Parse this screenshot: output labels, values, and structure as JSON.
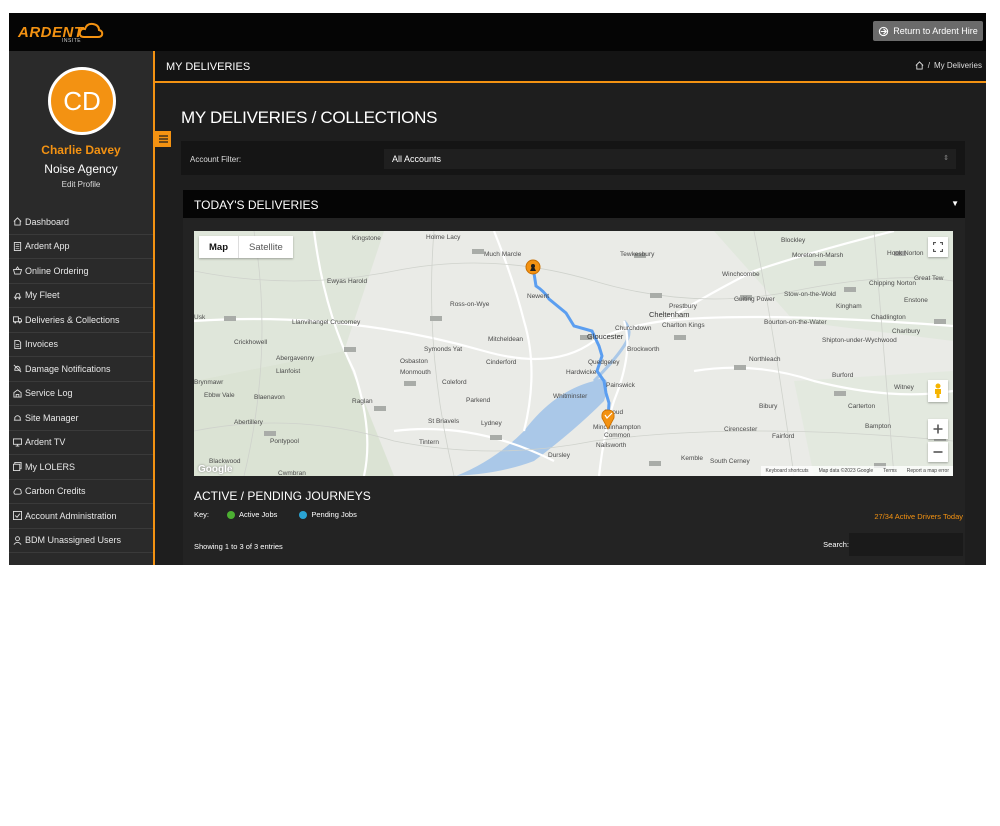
{
  "brand": {
    "name": "ARDENT",
    "sub": "INSITE",
    "accent": "#f39212"
  },
  "topbar": {
    "return_label": "Return to Ardent Hire"
  },
  "user": {
    "initials": "CD",
    "name": "Charlie Davey",
    "company": "Noise Agency",
    "edit_profile": "Edit Profile"
  },
  "nav": {
    "items": [
      {
        "label": "Dashboard",
        "icon": "home-icon"
      },
      {
        "label": "Ardent App",
        "icon": "document-icon"
      },
      {
        "label": "Online Ordering",
        "icon": "basket-icon"
      },
      {
        "label": "My Fleet",
        "icon": "fleet-icon"
      },
      {
        "label": "Deliveries & Collections",
        "icon": "truck-icon"
      },
      {
        "label": "Invoices",
        "icon": "invoice-icon"
      },
      {
        "label": "Damage Notifications",
        "icon": "alert-slash-icon"
      },
      {
        "label": "Service Log",
        "icon": "service-icon"
      },
      {
        "label": "Site Manager",
        "icon": "site-icon"
      },
      {
        "label": "Ardent TV",
        "icon": "monitor-icon"
      },
      {
        "label": "My LOLERS",
        "icon": "lolers-icon"
      },
      {
        "label": "Carbon Credits",
        "icon": "carbon-icon"
      },
      {
        "label": "Account Administration",
        "icon": "check-square-icon"
      },
      {
        "label": "BDM Unassigned Users",
        "icon": "user-icon"
      }
    ]
  },
  "header": {
    "section_title": "MY DELIVERIES",
    "breadcrumb_current": "My Deliveries",
    "breadcrumb_sep": "/"
  },
  "main": {
    "title": "MY DELIVERIES / COLLECTIONS",
    "filter": {
      "label": "Account Filter:",
      "value": "All Accounts"
    }
  },
  "deliveries": {
    "title": "TODAY'S DELIVERIES",
    "map": {
      "tabs": [
        "Map",
        "Satellite"
      ],
      "places": [
        "Kingstone",
        "Holme Lacy",
        "Much Marcle",
        "Tewkesbury",
        "Blockley",
        "Moreton-in-Marsh",
        "Hook Norton",
        "Ewyas Harold",
        "Winchcombe",
        "Great Tew",
        "Newent",
        "Stow-on-the-Wold",
        "Chipping Norton",
        "Ross-on-Wye",
        "Guiting Power",
        "Prestbury",
        "Kingham",
        "Enstone",
        "Usk",
        "Llanvihangel Crucorney",
        "Cheltenham",
        "Charlton Kings",
        "Bourton-on-the-Water",
        "Chadlington",
        "Churchdown",
        "Charlbury",
        "Crickhowell",
        "Mitcheldean",
        "Gloucester",
        "Shipton-under-Wychwood",
        "Brockworth",
        "Abergavenny",
        "Llanfoist",
        "Osbaston",
        "Monmouth",
        "Symonds Yat",
        "Cinderford",
        "Quedgeley",
        "Hardwicke",
        "Northleach",
        "Brynmawr",
        "Ebbw Vale",
        "Coleford",
        "Painswick",
        "Burford",
        "Witney",
        "Blaenavon",
        "Raglan",
        "Parkend",
        "Whitminster",
        "Stroud",
        "Bibury",
        "Carterton",
        "Abertillery",
        "St Briavels",
        "Lydney",
        "Minchinhampton",
        "Common",
        "Cirencester",
        "Bampton",
        "Pontypool",
        "Tintern",
        "Nailsworth",
        "Fairford",
        "Blackwood",
        "Dursley",
        "Kemble",
        "South Cerney",
        "Cwmbran"
      ],
      "footer": [
        "Keyboard shortcuts",
        "Map data ©2023 Google",
        "Terms",
        "Report a map error"
      ],
      "attribution": "Google"
    }
  },
  "journeys": {
    "title": "ACTIVE / PENDING JOURNEYS",
    "key_label": "Key:",
    "key_items": [
      {
        "label": "Active Jobs",
        "color": "#4caf32"
      },
      {
        "label": "Pending Jobs",
        "color": "#2aa4d4"
      }
    ],
    "active_drivers": "27/34 Active Drivers Today",
    "showing": "Showing 1 to 3 of 3 entries",
    "search_label": "Search:",
    "search_value": ""
  }
}
